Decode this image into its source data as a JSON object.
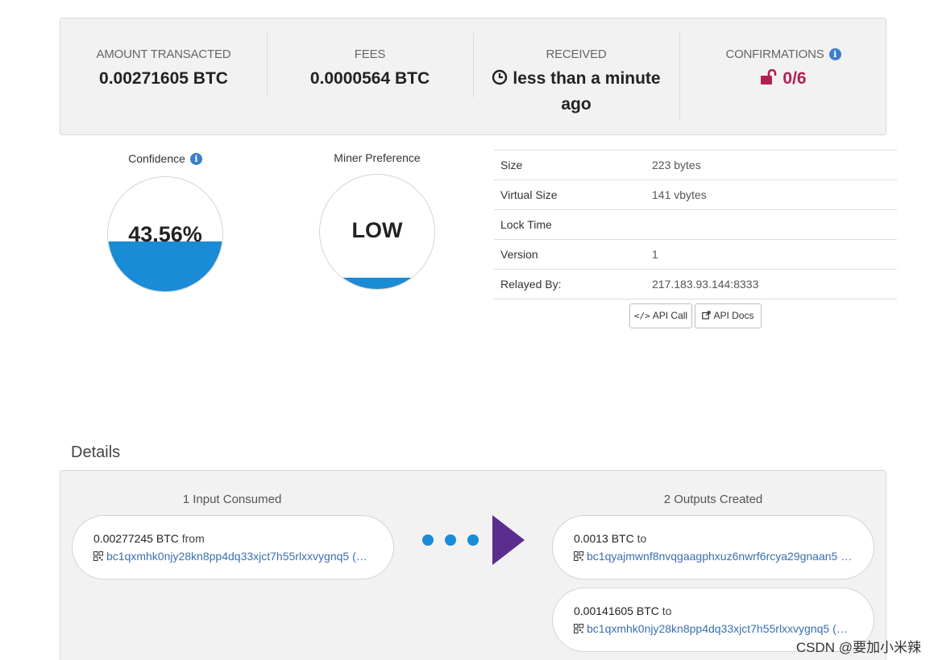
{
  "summary": {
    "amount_label": "AMOUNT TRANSACTED",
    "amount_value": "0.00271605 BTC",
    "fees_label": "FEES",
    "fees_value": "0.0000564 BTC",
    "received_label": "RECEIVED",
    "received_value": "less than a minute ago",
    "confirmations_label": "CONFIRMATIONS",
    "confirmations_value": "0/6",
    "confirmations_color": "#b0224f"
  },
  "gauges": {
    "confidence": {
      "title": "Confidence",
      "value_text": "43.56%",
      "fill_fraction": 0.4356,
      "color": "#1a8bd6"
    },
    "miner_preference": {
      "title": "Miner Preference",
      "value_text": "LOW",
      "fill_fraction": 0.1,
      "color": "#1a8bd6"
    }
  },
  "info_table": {
    "rows": [
      {
        "key": "Size",
        "value": "223 bytes"
      },
      {
        "key": "Virtual Size",
        "value": "141 vbytes"
      },
      {
        "key": "Lock Time",
        "value": ""
      },
      {
        "key": "Version",
        "value": "1"
      },
      {
        "key": "Relayed By:",
        "value": "217.183.93.144:8333"
      }
    ],
    "api_call_label": "API Call",
    "api_docs_label": "API Docs"
  },
  "details": {
    "title": "Details",
    "inputs_title": "1 Input Consumed",
    "outputs_title": "2 Outputs Created",
    "inputs": [
      {
        "amount": "0.00277245 BTC",
        "suffix": "from",
        "address": "bc1qxmhk0njy28kn8pp4dq33xjct7h55rlxxvygnq5 (…"
      }
    ],
    "outputs": [
      {
        "amount": "0.0013 BTC",
        "suffix": "to",
        "address": "bc1qyajmwnf8nvqgaagphxuz6nwrf6rcya29gnaan5 …"
      },
      {
        "amount": "0.00141605 BTC",
        "suffix": "to",
        "address": "bc1qxmhk0njy28kn8pp4dq33xjct7h55rlxxvygnq5 (…"
      }
    ],
    "arrow_color": "#5b2d8e"
  },
  "watermark": "CSDN @要加小米辣"
}
